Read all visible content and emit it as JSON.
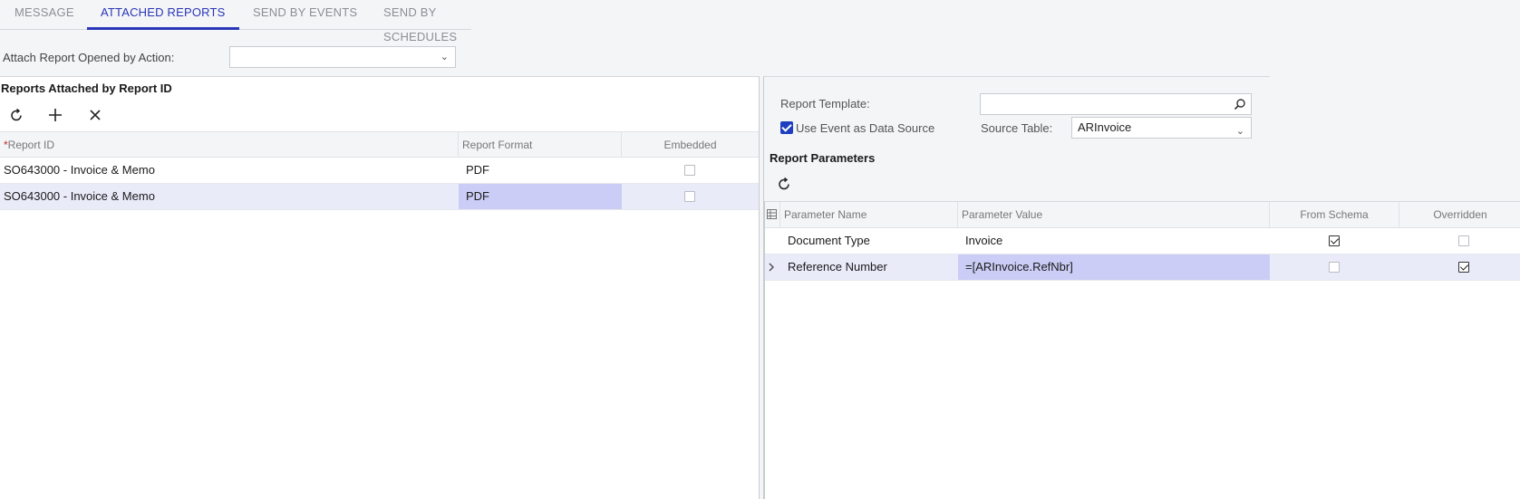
{
  "tabs": [
    {
      "label": "MESSAGE"
    },
    {
      "label": "ATTACHED REPORTS"
    },
    {
      "label": "SEND BY EVENTS"
    },
    {
      "label": "SEND BY SCHEDULES"
    }
  ],
  "attach_action": {
    "label": "Attach Report Opened by Action:",
    "value": ""
  },
  "left": {
    "title": "Reports Attached by Report ID",
    "columns": {
      "report_id": "Report ID",
      "report_format": "Report Format",
      "embedded": "Embedded"
    },
    "rows": [
      {
        "report_id": "SO643000 - Invoice & Memo",
        "report_format": "PDF",
        "embedded": false
      },
      {
        "report_id": "SO643000 - Invoice & Memo",
        "report_format": "PDF",
        "embedded": false
      }
    ]
  },
  "right": {
    "report_template_label": "Report Template:",
    "report_template_value": "",
    "use_event_label": "Use Event as Data Source",
    "use_event_checked": true,
    "source_table_label": "Source Table:",
    "source_table_value": "ARInvoice",
    "params_title": "Report Parameters",
    "columns": {
      "name": "Parameter Name",
      "value": "Parameter Value",
      "from_schema": "From Schema",
      "overridden": "Overridden"
    },
    "rows": [
      {
        "name": "Document Type",
        "value": "Invoice",
        "from_schema": true,
        "overridden": false
      },
      {
        "name": "Reference Number",
        "value": "=[ARInvoice.RefNbr]",
        "from_schema": false,
        "overridden": true
      }
    ]
  },
  "colors": {
    "accent": "#2a36b8",
    "selected_row": "#e9ebf9",
    "active_cell": "#cbcdf6",
    "required": "#c62828"
  },
  "icons": [
    "refresh-icon",
    "plus-icon",
    "close-icon",
    "chevron-down-icon",
    "search-icon",
    "grid-settings-icon",
    "chevron-right-icon"
  ]
}
